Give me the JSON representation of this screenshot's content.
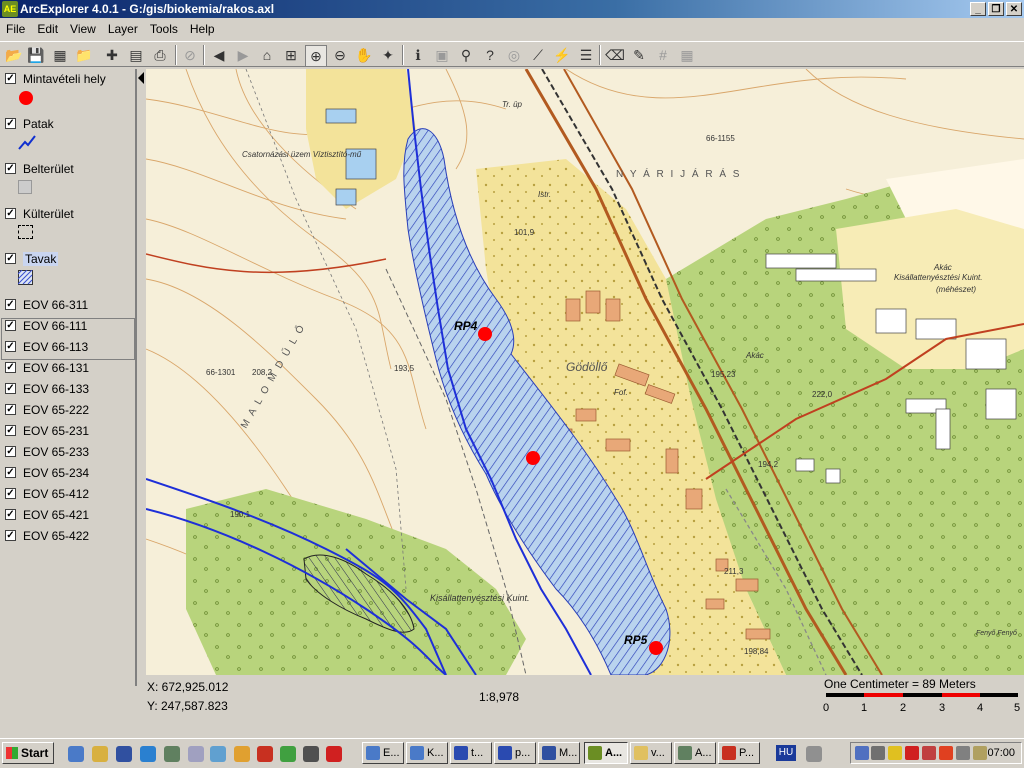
{
  "window": {
    "title": "ArcExplorer 4.0.1 - G:/gis/biokemia/rakos.axl",
    "app_icon": "arcexplorer-icon",
    "controls": [
      "minimize",
      "restore",
      "close"
    ]
  },
  "menu": [
    "File",
    "Edit",
    "View",
    "Layer",
    "Tools",
    "Help"
  ],
  "toolbar_icons": [
    "open-icon",
    "save-icon",
    "save-as-icon",
    "export-icon",
    "add-layer-icon",
    "catalog-icon",
    "print-icon",
    "stop-icon",
    "back-icon",
    "forward-icon",
    "zoom-full-icon",
    "zoom-layer-icon",
    "zoom-in-icon",
    "zoom-out-icon",
    "pan-icon",
    "globe-icon",
    "identify-icon",
    "select-icon",
    "find-icon",
    "query-icon",
    "buffer-icon",
    "measure-icon",
    "hyperlink-icon",
    "properties-icon",
    "clear-icon",
    "select-features-icon",
    "grid-icon",
    "table-icon"
  ],
  "layers": [
    {
      "label": "Mintavételi hely",
      "checked": true,
      "symbol": "red-dot",
      "color": "#ff0000"
    },
    {
      "label": "Patak",
      "checked": true,
      "symbol": "blue-line",
      "color": "#1030d0"
    },
    {
      "label": "Belterület",
      "checked": true,
      "symbol": "gray-box"
    },
    {
      "label": "Külterület",
      "checked": true,
      "symbol": "dashed-box"
    },
    {
      "label": "Tavak",
      "checked": true,
      "symbol": "hatched-box",
      "color": "#3a4fd0",
      "selected": true
    },
    {
      "label": "EOV 66-311",
      "checked": true
    },
    {
      "label": "EOV 66-111",
      "checked": true
    },
    {
      "label": "EOV 66-113",
      "checked": true
    },
    {
      "label": "EOV 66-131",
      "checked": true
    },
    {
      "label": "EOV 66-133",
      "checked": true
    },
    {
      "label": "EOV 65-222",
      "checked": true
    },
    {
      "label": "EOV 65-231",
      "checked": true
    },
    {
      "label": "EOV 65-233",
      "checked": true
    },
    {
      "label": "EOV 65-234",
      "checked": true
    },
    {
      "label": "EOV 65-412",
      "checked": true
    },
    {
      "label": "EOV 65-421",
      "checked": true
    },
    {
      "label": "EOV 65-422",
      "checked": true
    }
  ],
  "map": {
    "sample_points": [
      "RP4",
      "RP5"
    ],
    "labels": {
      "town": "Gödöllő",
      "farm1": "Kisállattenyésztési Kuint.",
      "farm2": "Kisállattenyésztési Kuint.",
      "district": "N Y Á R I   J Á R Á S",
      "malom": "M A L O M   D Ű L Ő",
      "pump": "Csatornázási üzem Víztisztító-mű",
      "elev1": "66-1301",
      "elev1_val": "208,2",
      "elev2": "66-1155",
      "elev3": "195,23",
      "elev4": "222,0",
      "elev5": "194,2",
      "elev6": "211,3",
      "elev7": "198,84",
      "elev8": "190,1",
      "elev9": "193,5",
      "elev10": "101,9",
      "fof": "Fof.",
      "akac1": "Akác",
      "akac2": "Akác",
      "mehgeszet": "(méhészet)",
      "tr": "Tr. üp",
      "istr": "Istr.",
      "ert": "Fenyő Fenyő"
    },
    "colors": {
      "background": "#f6efd9",
      "forest": "#b8d47c",
      "urban": "#f3e39a",
      "lake": "#b9d3ee",
      "stream": "#1e2fd8",
      "sample": "#ff0000"
    }
  },
  "status": {
    "x": "X: 672,925.012",
    "y": "Y: 247,587.823",
    "scale": "1:8,978"
  },
  "scalebar": {
    "title": "One Centimeter = 89 Meters",
    "ticks": [
      "0",
      "1",
      "2",
      "3",
      "4",
      "5"
    ]
  },
  "taskbar": {
    "start": "Start",
    "quicklaunch_icons": [
      "explorer-icon",
      "outlook-icon",
      "feather-icon",
      "ie-icon",
      "search-icon",
      "notepad-icon",
      "network-icon",
      "winamp-icon",
      "paint-icon",
      "plant-icon",
      "media-icon",
      "total-icon"
    ],
    "tasks": [
      {
        "label": "E..."
      },
      {
        "label": "K..."
      },
      {
        "label": "t..."
      },
      {
        "label": "p..."
      },
      {
        "label": "M..."
      },
      {
        "label": "A...",
        "active": true
      },
      {
        "label": "v..."
      },
      {
        "label": "A..."
      },
      {
        "label": "P..."
      }
    ],
    "lang": "HU",
    "tray_icons": [
      "network-icon",
      "volume-icon",
      "warning-icon",
      "za-icon",
      "virus-icon",
      "antivirus-icon",
      "printer-icon",
      "security-icon"
    ],
    "clock": "07:00"
  }
}
